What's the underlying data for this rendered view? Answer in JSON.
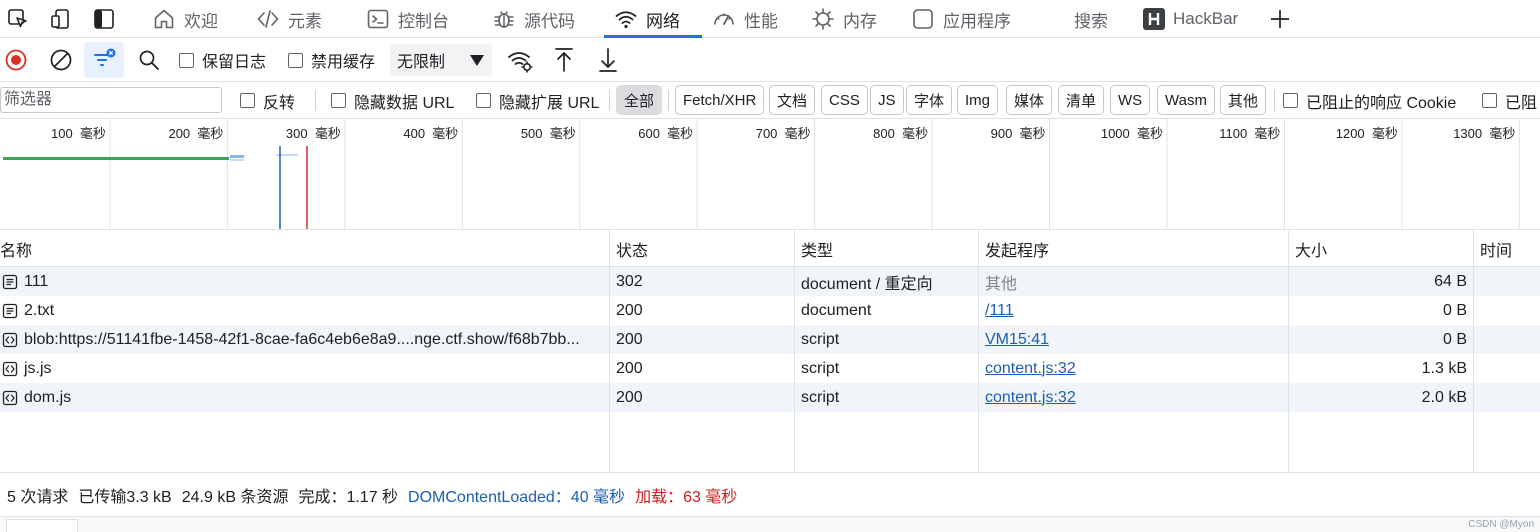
{
  "tabs": [
    {
      "label": "欢迎",
      "icon": "home-icon"
    },
    {
      "label": "元素",
      "icon": "code-brackets-icon"
    },
    {
      "label": "控制台",
      "icon": "console-icon"
    },
    {
      "label": "源代码",
      "icon": "bug-icon"
    },
    {
      "label": "网络",
      "icon": "wifi-icon",
      "active": true
    },
    {
      "label": "性能",
      "icon": "gauge-icon"
    },
    {
      "label": "内存",
      "icon": "memory-chip-icon"
    },
    {
      "label": "应用程序",
      "icon": "application-icon"
    },
    {
      "label": "搜索"
    },
    {
      "label": "HackBar",
      "icon": "hackbar-h-icon"
    }
  ],
  "toolbar": {
    "preserve_log": "保留日志",
    "disable_cache": "禁用缓存",
    "throttling": "无限制"
  },
  "filter": {
    "placeholder": "筛选器",
    "invert": "反转",
    "hide_data_urls": "隐藏数据 URL",
    "hide_extension_urls": "隐藏扩展 URL",
    "types": [
      "全部",
      "Fetch/XHR",
      "文档",
      "CSS",
      "JS",
      "字体",
      "Img",
      "媒体",
      "清单",
      "WS",
      "Wasm",
      "其他"
    ],
    "blocked_response_cookies": "已阻止的响应 Cookie",
    "blocked_requests": "已阻"
  },
  "overview": {
    "tick_unit": "毫秒",
    "ticks": [
      100,
      200,
      300,
      400,
      500,
      600,
      700,
      800,
      900,
      1000,
      1100,
      1200,
      1300
    ],
    "dom_content_loaded_ms": 40,
    "load_ms": 63,
    "dom_color": "#1a5fb4",
    "load_color": "#d93025"
  },
  "table": {
    "columns": [
      "名称",
      "状态",
      "类型",
      "发起程序",
      "大小",
      "时间"
    ],
    "rows": [
      {
        "name": "111",
        "icon": "document-icon",
        "status": "302",
        "type": "document / 重定向",
        "initiator": "其他",
        "initiator_link": false,
        "size": "64 B"
      },
      {
        "name": "2.txt",
        "icon": "document-icon",
        "status": "200",
        "type": "document",
        "initiator": "/111",
        "initiator_link": true,
        "size": "0 B"
      },
      {
        "name": "blob:https://51141fbe-1458-42f1-8cae-fa6c4eb6e8a9....nge.ctf.show/f68b7bb...",
        "icon": "script-icon",
        "status": "200",
        "type": "script",
        "initiator": "VM15:41",
        "initiator_link": true,
        "size": "0 B"
      },
      {
        "name": "js.js",
        "icon": "script-icon",
        "status": "200",
        "type": "script",
        "initiator": "content.js:32",
        "initiator_link": true,
        "size": "1.3 kB"
      },
      {
        "name": "dom.js",
        "icon": "script-icon",
        "status": "200",
        "type": "script",
        "initiator": "content.js:32",
        "initiator_link": true,
        "size": "2.0 kB"
      }
    ]
  },
  "status": {
    "requests": "5 次请求",
    "transferred": "已传输3.3 kB",
    "resources": "24.9 kB 条资源",
    "finish": "完成：1.17 秒",
    "dom_content_loaded": "DOMContentLoaded：40  毫秒",
    "load": "加载：63  毫秒"
  },
  "watermark": "CSDN @Myon⁠",
  "colors": {
    "accent": "#1a73e8",
    "record_red": "#d93025",
    "link": "#1a5fb4"
  }
}
